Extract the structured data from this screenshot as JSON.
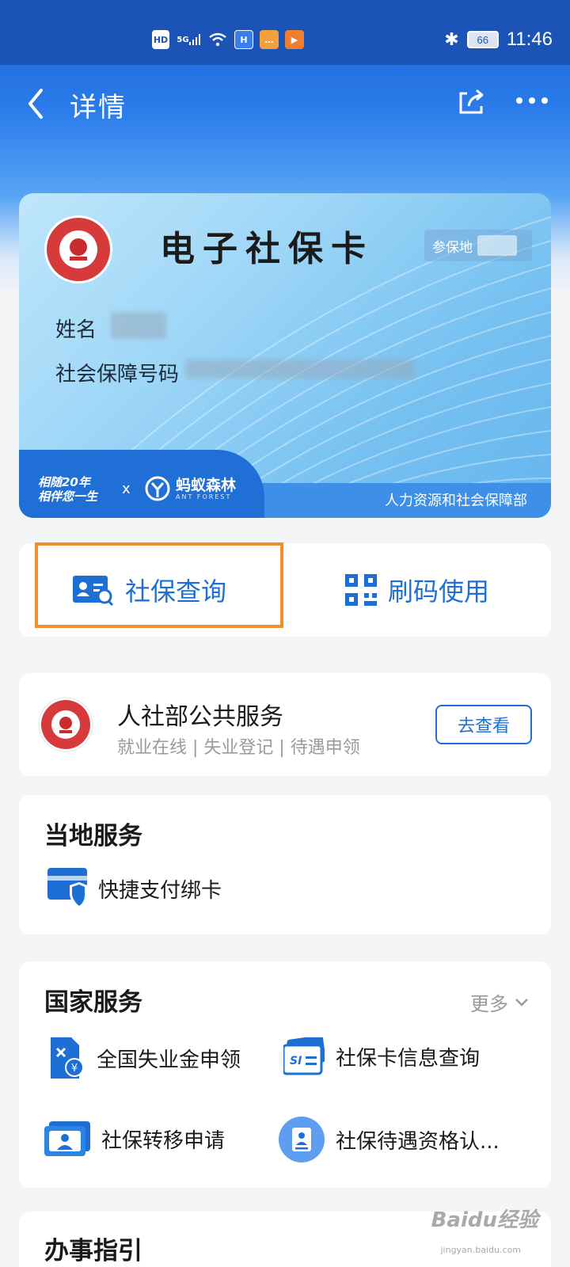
{
  "status_bar": {
    "hd": "HD",
    "signal": "5G",
    "battery": "66",
    "time": "11:46"
  },
  "nav": {
    "title": "详情"
  },
  "card": {
    "title": "电子社保卡",
    "insured_place_label": "参保地",
    "name_label": "姓名",
    "ssn_label": "社会保障号码",
    "slogan_line1": "相随20年",
    "slogan_line2": "相伴您一生",
    "x": "x",
    "partner_name": "蚂蚁森林",
    "partner_sub": "ANT FOREST",
    "issuer": "人力资源和社会保障部"
  },
  "actions": {
    "query": "社保查询",
    "scan": "刷码使用"
  },
  "public_service": {
    "title": "人社部公共服务",
    "subtitle": "就业在线 | 失业登记 | 待遇申领",
    "button": "去查看"
  },
  "local_services": {
    "title": "当地服务",
    "items": [
      {
        "label": "快捷支付绑卡"
      }
    ]
  },
  "national_services": {
    "title": "国家服务",
    "more": "更多",
    "items": [
      {
        "label": "全国失业金申领"
      },
      {
        "label": "社保卡信息查询"
      },
      {
        "label": "社保转移申请"
      },
      {
        "label": "社保待遇资格认..."
      }
    ]
  },
  "guide": {
    "title": "办事指引"
  },
  "watermark": {
    "brand": "Baidu经验",
    "url": "jingyan.baidu.com"
  },
  "colors": {
    "primary": "#1d6fd6",
    "highlight": "#f38d2c",
    "nav": "#1b53b6"
  }
}
